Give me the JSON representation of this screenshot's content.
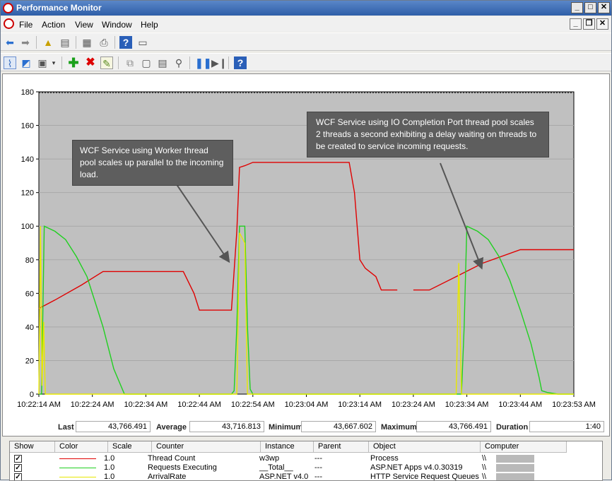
{
  "window": {
    "title": "Performance Monitor"
  },
  "menu": [
    "File",
    "Action",
    "View",
    "Window",
    "Help"
  ],
  "toolbar1": [
    "back-icon",
    "forward-icon",
    "up-folder-icon",
    "show-hide-tree-icon",
    "export-list-icon",
    "print-icon",
    "help-icon",
    "properties-icon"
  ],
  "toolbar2": [
    "view-graph-icon",
    "view-current-activity-icon",
    "change-graph-type-icon",
    "dropdown-icon",
    "add-counter-icon",
    "delete-counter-icon",
    "highlight-icon",
    "copy-properties-icon",
    "paste-counter-icon",
    "properties-icon",
    "zoom-icon",
    "freeze-display-icon",
    "update-data-icon",
    "help-icon"
  ],
  "callouts": [
    {
      "text": "WCF Service using Worker thread pool scales up parallel to the incoming load."
    },
    {
      "text": "WCF Service using IO Completion Port thread pool scales 2 threads a second exhibiting a delay waiting on threads to be created to service incoming requests."
    }
  ],
  "chart_data": {
    "type": "line",
    "ylim": [
      0,
      180
    ],
    "y_ticks": [
      "180",
      "160",
      "140",
      "120",
      "100",
      "80",
      "60",
      "40",
      "20",
      "0"
    ],
    "x_ticks": [
      "10:22:14 AM",
      "10:22:24 AM",
      "10:22:34 AM",
      "10:22:44 AM",
      "10:22:54 AM",
      "10:23:04 AM",
      "10:23:14 AM",
      "10:23:24 AM",
      "10:23:34 AM",
      "10:23:44 AM",
      "10:23:53 AM"
    ],
    "series": [
      {
        "name": "Thread Count",
        "color": "#e00000",
        "points": [
          [
            0,
            51
          ],
          [
            3,
            56
          ],
          [
            8,
            65
          ],
          [
            12,
            73
          ],
          [
            27,
            73
          ],
          [
            29,
            60
          ],
          [
            30,
            50
          ],
          [
            36,
            50
          ],
          [
            37,
            97
          ],
          [
            37.5,
            135
          ],
          [
            38.5,
            136
          ],
          [
            40,
            138
          ],
          [
            58,
            138
          ],
          [
            59,
            120
          ],
          [
            60,
            80
          ],
          [
            61,
            75
          ],
          [
            63,
            70
          ],
          [
            64,
            62
          ],
          [
            67,
            62
          ],
          [
            67.5,
            null
          ],
          [
            70,
            62
          ],
          [
            73,
            62
          ],
          [
            78,
            70
          ],
          [
            83,
            78
          ],
          [
            90,
            86
          ],
          [
            100,
            86
          ]
        ]
      },
      {
        "name": "Requests Executing",
        "color": "#20d020",
        "points": [
          [
            0,
            0
          ],
          [
            0.5,
            0
          ],
          [
            1,
            100
          ],
          [
            3,
            97
          ],
          [
            5,
            92
          ],
          [
            7,
            82
          ],
          [
            9,
            70
          ],
          [
            11,
            50
          ],
          [
            12,
            40
          ],
          [
            14,
            15
          ],
          [
            16,
            0
          ],
          [
            36,
            0
          ],
          [
            36.5,
            2
          ],
          [
            37,
            40
          ],
          [
            37.5,
            100
          ],
          [
            38.5,
            100
          ],
          [
            39,
            40
          ],
          [
            39.5,
            3
          ],
          [
            40,
            0
          ],
          [
            79,
            0
          ],
          [
            79.5,
            40
          ],
          [
            80,
            100
          ],
          [
            82,
            97
          ],
          [
            84,
            92
          ],
          [
            86,
            82
          ],
          [
            88,
            68
          ],
          [
            90,
            50
          ],
          [
            92,
            30
          ],
          [
            93.5,
            10
          ],
          [
            94,
            2
          ],
          [
            95,
            1
          ],
          [
            97,
            0
          ],
          [
            100,
            0
          ]
        ]
      },
      {
        "name": "ArrivalRate",
        "color": "#e8e800",
        "points": [
          [
            0,
            0
          ],
          [
            0.3,
            100
          ],
          [
            0.6,
            5
          ],
          [
            0.9,
            43
          ],
          [
            1.2,
            0
          ],
          [
            37,
            0
          ],
          [
            37.5,
            96
          ],
          [
            38.5,
            90
          ],
          [
            39,
            0
          ],
          [
            78,
            0
          ],
          [
            78.5,
            78
          ],
          [
            79,
            0
          ],
          [
            79.5,
            0
          ],
          [
            100,
            0
          ]
        ]
      }
    ]
  },
  "stats": {
    "last_label": "Last",
    "last": "43,766.491",
    "average_label": "Average",
    "average": "43,716.813",
    "minimum_label": "Minimum",
    "minimum": "43,667.602",
    "maximum_label": "Maximum",
    "maximum": "43,766.491",
    "duration_label": "Duration",
    "duration": "1:40"
  },
  "legend": {
    "headers": [
      "Show",
      "Color",
      "Scale",
      "Counter",
      "Instance",
      "Parent",
      "Object",
      "Computer"
    ],
    "rows": [
      {
        "show": "✓",
        "color": "#e00000",
        "scale": "1.0",
        "counter": "Thread Count",
        "instance": "w3wp",
        "parent": "---",
        "object": "Process",
        "computer": "\\\\"
      },
      {
        "show": "✓",
        "color": "#20d020",
        "scale": "1.0",
        "counter": "Requests Executing",
        "instance": "__Total__",
        "parent": "---",
        "object": "ASP.NET Apps v4.0.30319",
        "computer": "\\\\"
      },
      {
        "show": "✓",
        "color": "#e8e800",
        "scale": "1.0",
        "counter": "ArrivalRate",
        "instance": "ASP.NET v4.0",
        "parent": "---",
        "object": "HTTP Service Request Queues",
        "computer": "\\\\"
      }
    ]
  }
}
